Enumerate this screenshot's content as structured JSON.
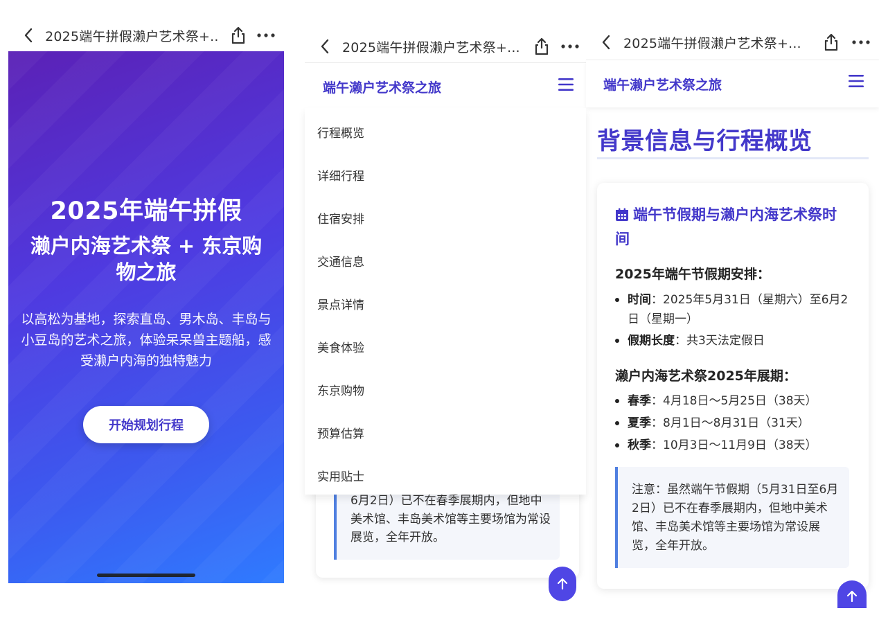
{
  "browser": {
    "page_title": "2025端午拼假濑户艺术祭+..."
  },
  "hero": {
    "heading": "2025年端午拼假",
    "subheading": "濑户内海艺术祭 + 东京购物之旅",
    "description": "以高松为基地，探索直岛、男木岛、丰岛与小豆岛的艺术之旅，体验呆呆兽主题船，感受濑户内海的独特魅力",
    "cta_label": "开始规划行程"
  },
  "site": {
    "brand": "端午濑户艺术祭之旅"
  },
  "nav_menu": {
    "items": [
      "行程概览",
      "详细行程",
      "住宿安排",
      "交通信息",
      "景点详情",
      "美食体验",
      "东京购物",
      "预算估算",
      "实用贴士"
    ]
  },
  "section": {
    "title": "背景信息与行程概览",
    "card_title": "端午节假期与濑户内海艺术祭时间",
    "holiday_heading": "2025年端午节假期安排：",
    "holiday_items": [
      {
        "label": "时间",
        "text": "：2025年5月31日（星期六）至6月2日（星期一）"
      },
      {
        "label": "假期长度",
        "text": "：共3天法定假日"
      }
    ],
    "festival_heading": "濑户内海艺术祭2025年展期：",
    "festival_items": [
      {
        "label": "春季",
        "text": "：4月18日～5月25日（38天）"
      },
      {
        "label": "夏季",
        "text": "：8月1日～8月31日（31天）"
      },
      {
        "label": "秋季",
        "text": "：10月3日～11月9日（38天）"
      }
    ],
    "note_full": "注意：虽然端午节假期（5月31日至6月2日）已不在春季展期内，但地中美术馆、丰岛美术馆等主要场馆为常设展览，全年开放。",
    "note_partial": "6月2日）已不在春季展期内，但地中美术馆、丰岛美术馆等主要场馆为常设展览，全年开放。"
  },
  "colors": {
    "accent": "#4338ca",
    "fab": "#4f46e5",
    "note_border": "#4f7fe0"
  }
}
